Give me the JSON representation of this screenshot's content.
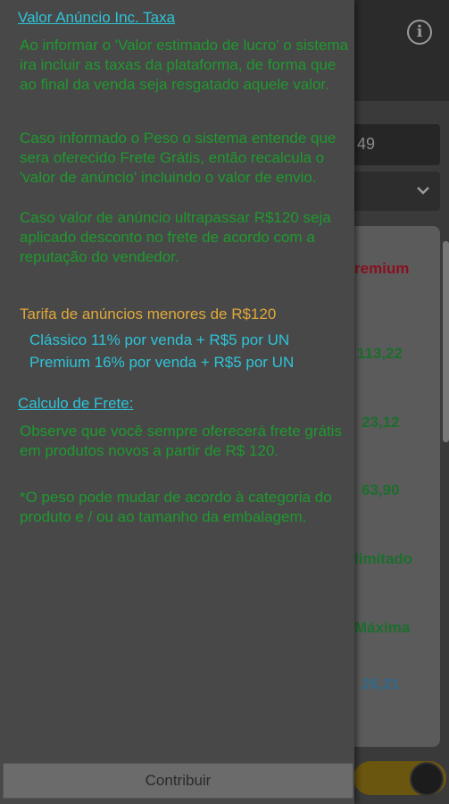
{
  "background": {
    "input_value_partial": "49",
    "card": {
      "col_header": "remium",
      "v1": "113,22",
      "v2": "23,12",
      "v3": "63,90",
      "row_limit": "limitado",
      "row_max": "Máxima",
      "v4": "26,21"
    },
    "toggle_on": true
  },
  "drawer": {
    "heading_valor": "Valor Anúncio Inc. Taxa",
    "para1": "Ao informar o 'Valor estimado de lucro' o sistema ira incluir as taxas da plataforma, de forma que ao final da venda seja resgatado aquele valor.",
    "para2": "Caso informado o Peso o sistema entende que sera oferecido Frete Grátis, então recalcula o 'valor de anúncio' incluindo o valor de envio.",
    "para3": "Caso valor de anúncio ultrapassar R$120 seja aplicado desconto no frete de acordo com a reputação do vendedor.",
    "tarifa_title": "Tarifa de anúncios menores de R$120",
    "tarifa_classico": "Clássico  11% por venda + R$5 por UN",
    "tarifa_premium": "Premium 16% por venda + R$5 por UN",
    "heading_frete": "Calculo de Frete:",
    "para4": "Observe que você sempre oferecerá frete grátis em produtos novos a partir de R$ 120.",
    "para5": "*O peso pode mudar de acordo à categoria do produto e / ou ao tamanho da embalagem.",
    "contribuir_label": "Contribuir"
  },
  "colors": {
    "heading": "#2ec4d8",
    "paragraph": "#1e9a2e",
    "tarifa_title": "#e0a83a",
    "drawer_bg": "#484848"
  },
  "icons": [
    "info-icon",
    "chevron-down-icon"
  ]
}
